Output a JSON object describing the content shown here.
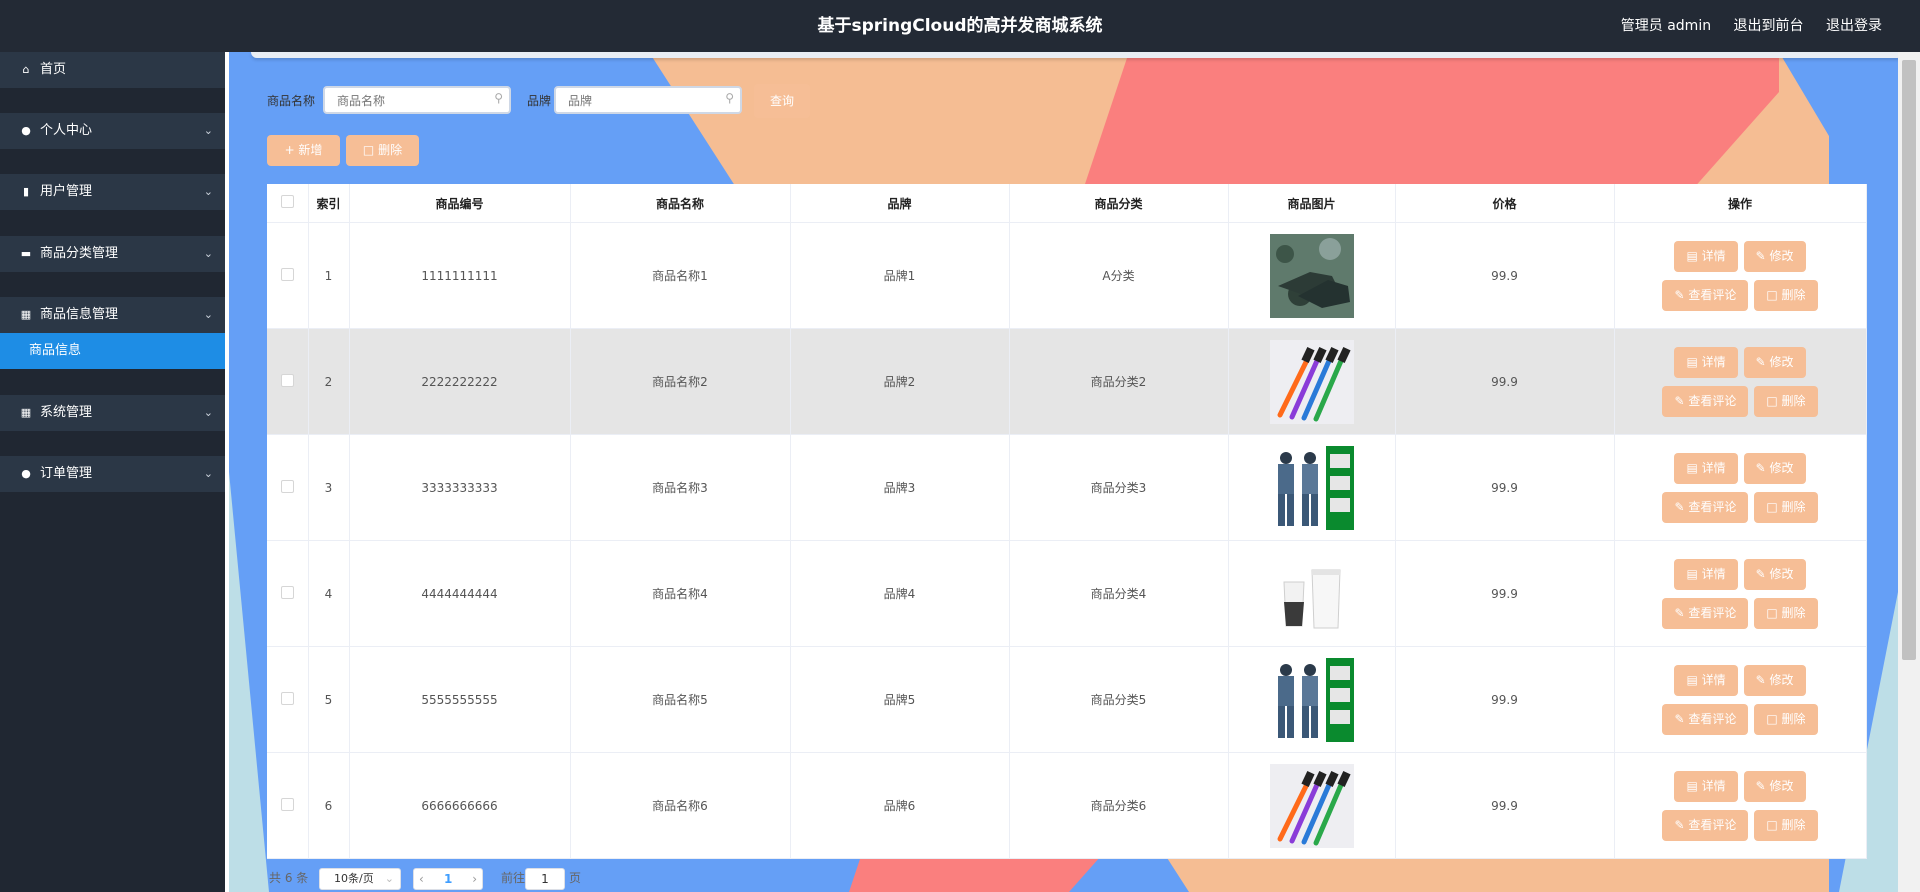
{
  "header": {
    "title": "基于springCloud的高并发商城系统",
    "user": "管理员 admin",
    "to_front": "退出到前台",
    "logout": "退出登录"
  },
  "sidebar": {
    "items": [
      {
        "label": "首页",
        "icon": "home-icon",
        "expandable": false
      },
      {
        "label": "个人中心",
        "icon": "user-icon",
        "expandable": true
      },
      {
        "label": "用户管理",
        "icon": "clipboard-icon",
        "expandable": true
      },
      {
        "label": "商品分类管理",
        "icon": "monitor-icon",
        "expandable": true
      },
      {
        "label": "商品信息管理",
        "icon": "grid-icon",
        "expandable": true,
        "expanded": true
      },
      {
        "label": "系统管理",
        "icon": "grid-icon",
        "expandable": true
      },
      {
        "label": "订单管理",
        "icon": "pin-icon",
        "expandable": true
      }
    ],
    "active_sub": "商品信息"
  },
  "search": {
    "name_label": "商品名称",
    "name_placeholder": "商品名称",
    "brand_label": "品牌",
    "brand_placeholder": "品牌",
    "query_button": "查询"
  },
  "toolbar": {
    "add_label": "+ 新增",
    "delete_label": "删除"
  },
  "table": {
    "headers": [
      "索引",
      "商品编号",
      "商品名称",
      "品牌",
      "商品分类",
      "商品图片",
      "价格",
      "操作"
    ],
    "rows": [
      {
        "index": "1",
        "code": "1111111111",
        "name": "商品名称1",
        "brand": "品牌1",
        "category": "A分类",
        "image": "camo-shoes",
        "price": "99.9"
      },
      {
        "index": "2",
        "code": "2222222222",
        "name": "商品名称2",
        "brand": "品牌2",
        "category": "商品分类2",
        "image": "toothbrushes",
        "price": "99.9"
      },
      {
        "index": "3",
        "code": "3333333333",
        "name": "商品名称3",
        "brand": "品牌3",
        "category": "商品分类3",
        "image": "camo-uniform",
        "price": "99.9"
      },
      {
        "index": "4",
        "code": "4444444444",
        "name": "商品名称4",
        "brand": "品牌4",
        "category": "商品分类4",
        "image": "white-cups",
        "price": "99.9"
      },
      {
        "index": "5",
        "code": "5555555555",
        "name": "商品名称5",
        "brand": "品牌5",
        "category": "商品分类5",
        "image": "camo-uniform",
        "price": "99.9"
      },
      {
        "index": "6",
        "code": "6666666666",
        "name": "商品名称6",
        "brand": "品牌6",
        "category": "商品分类6",
        "image": "toothbrushes",
        "price": "99.9"
      }
    ],
    "actions": {
      "detail": "详情",
      "edit": "修改",
      "comments": "查看评论",
      "delete": "删除"
    }
  },
  "pager": {
    "total": "共 6 条",
    "page_size": "10条/页",
    "current": "1",
    "goto_label": "前往",
    "goto_value": "1",
    "goto_unit": "页"
  },
  "colors": {
    "header_bg": "#232a35",
    "sidebar_bg": "#202732",
    "menu_bg": "#2b3746",
    "active_bg": "#1e8de5",
    "button": "#f6be96",
    "bg_blue": "#659ff6",
    "bg_peach": "#f5bd93",
    "bg_red": "#fa7f7e",
    "bg_lightblue": "#bddee7"
  }
}
